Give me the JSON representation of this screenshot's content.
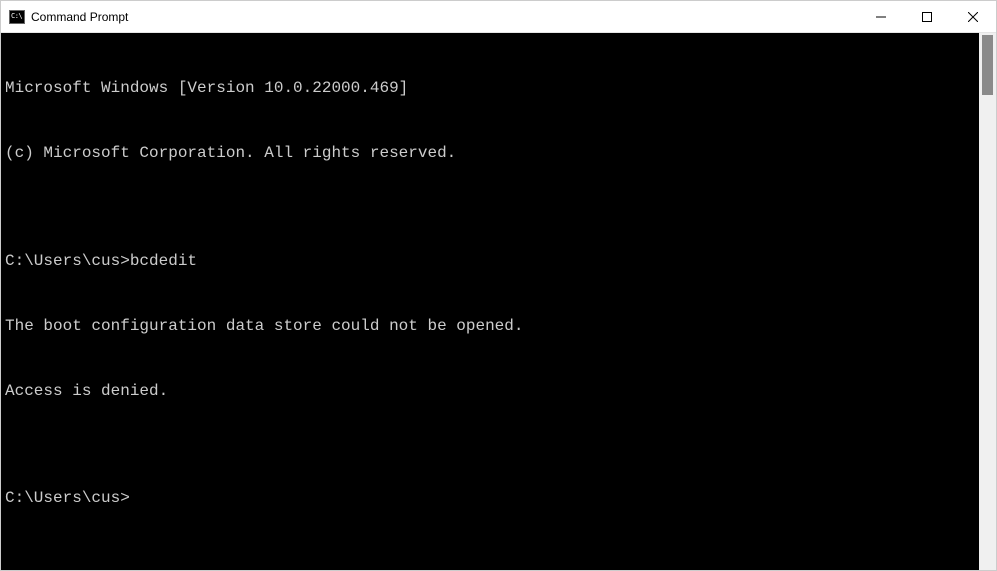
{
  "window": {
    "title": "Command Prompt"
  },
  "terminal": {
    "lines": [
      "Microsoft Windows [Version 10.0.22000.469]",
      "(c) Microsoft Corporation. All rights reserved.",
      "",
      "C:\\Users\\cus>bcdedit",
      "The boot configuration data store could not be opened.",
      "Access is denied.",
      "",
      "C:\\Users\\cus>"
    ]
  }
}
